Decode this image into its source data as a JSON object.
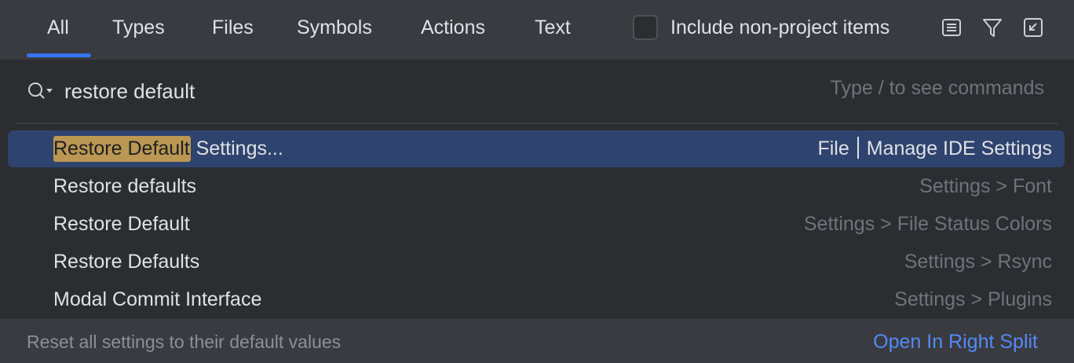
{
  "tabs": [
    {
      "label": "All",
      "active": true
    },
    {
      "label": "Types"
    },
    {
      "label": "Files"
    },
    {
      "label": "Symbols"
    },
    {
      "label": "Actions"
    },
    {
      "label": "Text"
    }
  ],
  "include_non_project": {
    "label": "Include non-project items",
    "checked": false
  },
  "toolbar_icons": [
    "preview-icon",
    "filter-icon",
    "open-in-tool-window-icon"
  ],
  "search": {
    "value": "restore default",
    "hint": "Type / to see commands"
  },
  "results": [
    {
      "highlight": "Restore Default",
      "rest": " Settings...",
      "path_a": "File",
      "path_b": "Manage IDE Settings",
      "selected": true
    },
    {
      "title": "Restore defaults",
      "path": "Settings > Font"
    },
    {
      "title": "Restore Default",
      "path": "Settings > File Status Colors"
    },
    {
      "title": "Restore Defaults",
      "path": "Settings > Rsync"
    },
    {
      "title": "Modal Commit Interface",
      "path": "Settings > Plugins"
    }
  ],
  "footer": {
    "description": "Reset all settings to their default values",
    "link": "Open In Right Split"
  },
  "colors": {
    "tabbar_bg": "#393b40",
    "panel_bg": "#2b2d30",
    "accent": "#3574f0",
    "selection_bg": "#2e436e",
    "match_highlight": "#ba9752",
    "link": "#548af7"
  }
}
